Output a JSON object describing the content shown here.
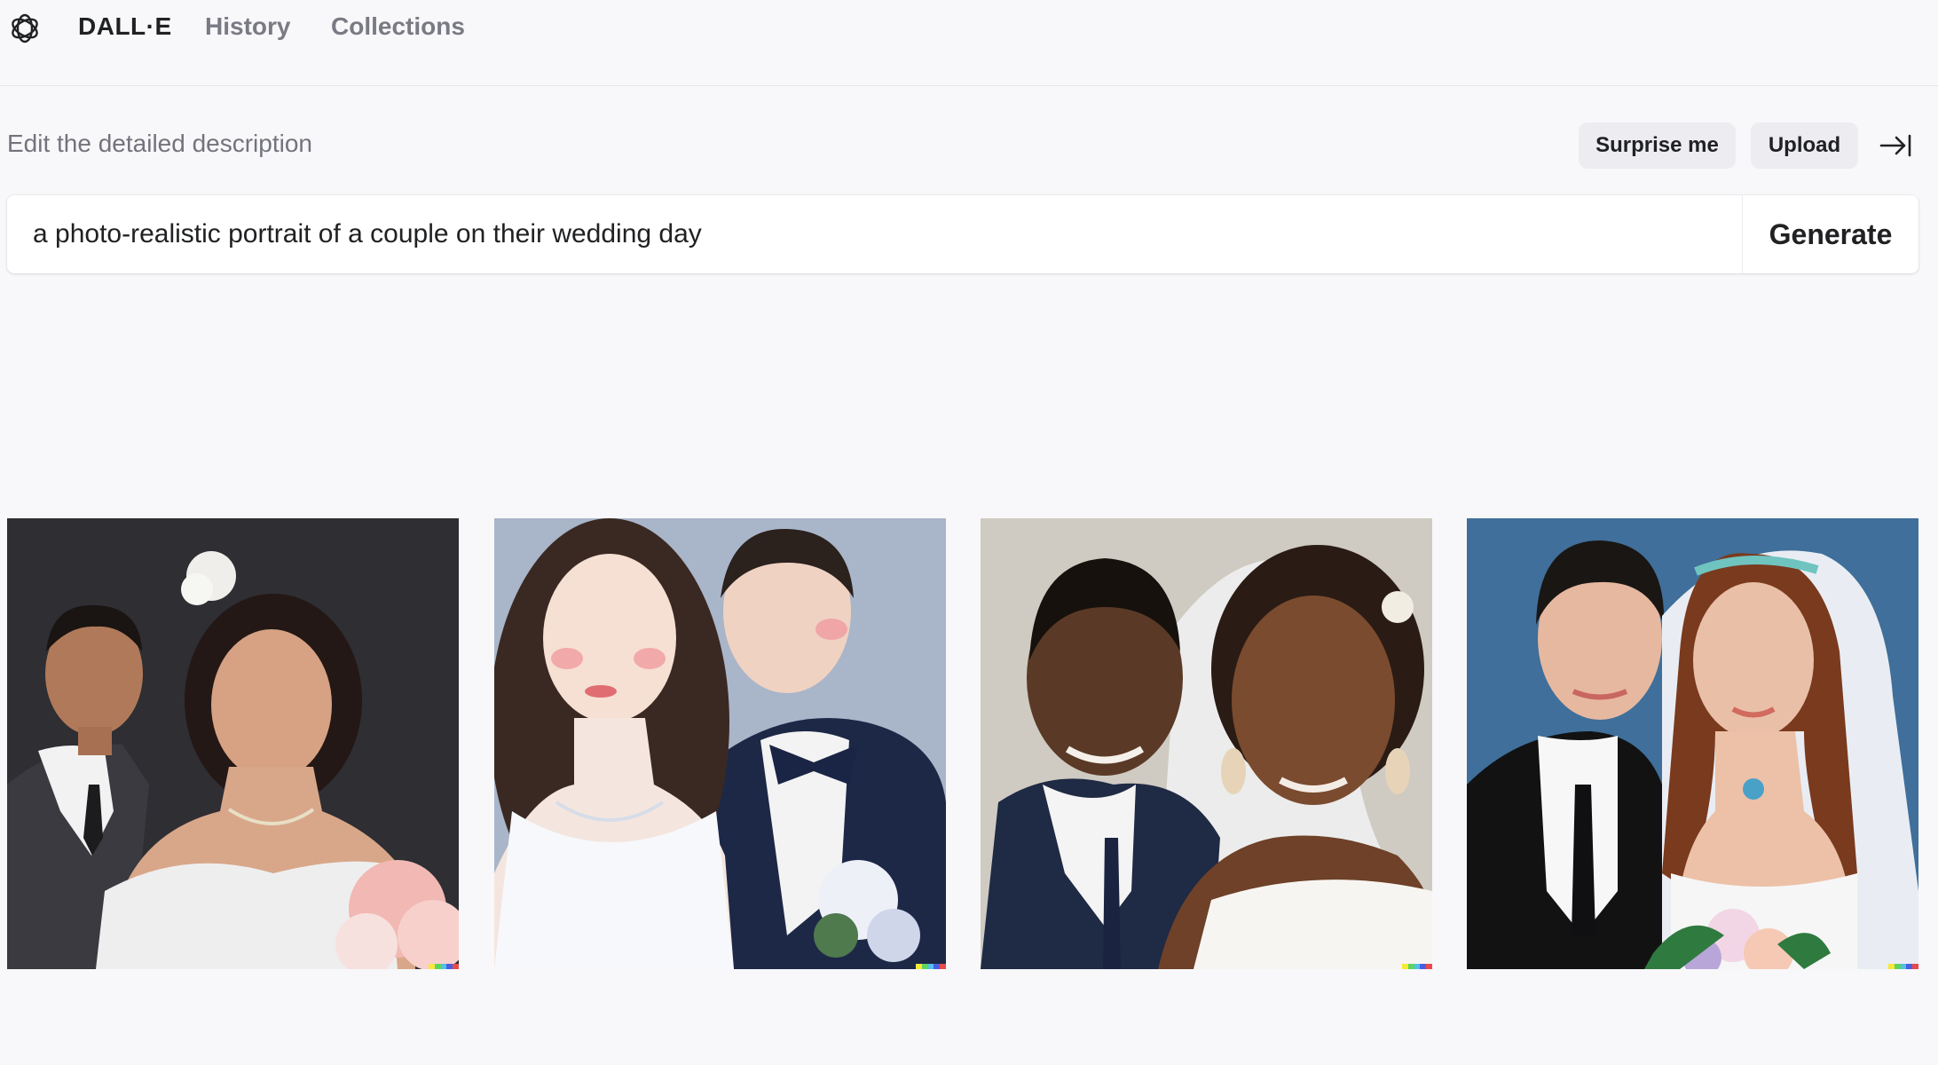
{
  "header": {
    "brand": "DALL·E",
    "nav": [
      {
        "label": "History"
      },
      {
        "label": "Collections"
      }
    ],
    "logo_icon": "openai-logo-icon"
  },
  "prompt": {
    "label": "Edit the detailed description",
    "surprise_label": "Surprise me",
    "upload_label": "Upload",
    "collapse_icon": "collapse-right-icon",
    "value": "a photo-realistic portrait of a couple on their wedding day",
    "generate_label": "Generate"
  },
  "results": {
    "images": [
      {
        "style": "photo",
        "background": "#2e2e33"
      },
      {
        "style": "painting",
        "background": "#a9b5c9"
      },
      {
        "style": "painting",
        "background": "#cfcbc2"
      },
      {
        "style": "painting",
        "background": "#3f6f9a"
      }
    ],
    "signature_colors": [
      "#f7e83a",
      "#5ed45e",
      "#53c0e8",
      "#4a5ee0",
      "#e84a4a"
    ]
  }
}
